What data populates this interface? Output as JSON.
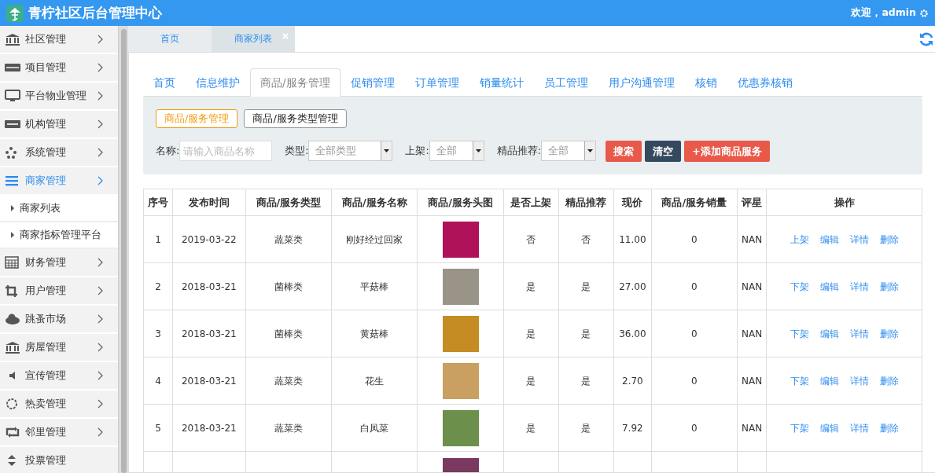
{
  "header": {
    "title": "青柠社区后台管理中心",
    "user": "欢迎，admin"
  },
  "sidebar": {
    "items": [
      {
        "label": "社区管理",
        "selected": false
      },
      {
        "label": "项目管理",
        "selected": false
      },
      {
        "label": "平台物业管理",
        "selected": false
      },
      {
        "label": "机构管理",
        "selected": false
      },
      {
        "label": "系统管理",
        "selected": false
      },
      {
        "label": "商家管理",
        "expanded": true,
        "selected": true,
        "children": [
          {
            "label": "商家列表"
          },
          {
            "label": "商家指标管理平台"
          }
        ]
      },
      {
        "label": "财务管理",
        "selected": false
      },
      {
        "label": "用户管理",
        "selected": false
      },
      {
        "label": "跳蚤市场",
        "selected": false
      },
      {
        "label": "房屋管理",
        "selected": false
      },
      {
        "label": "宣传管理",
        "selected": false
      },
      {
        "label": "热卖管理",
        "selected": false
      },
      {
        "label": "邻里管理",
        "selected": false
      },
      {
        "label": "投票管理",
        "selected": false
      }
    ]
  },
  "page_tabs": [
    {
      "label": "首页",
      "selected": false,
      "closable": false
    },
    {
      "label": "商家列表",
      "selected": true,
      "closable": true
    }
  ],
  "tabs": [
    {
      "label": "首页",
      "selected": false
    },
    {
      "label": "信息维护",
      "selected": false
    },
    {
      "label": "商品/服务管理",
      "selected": true
    },
    {
      "label": "促销管理",
      "selected": false
    },
    {
      "label": "订单管理",
      "selected": false
    },
    {
      "label": "销量统计",
      "selected": false
    },
    {
      "label": "员工管理",
      "selected": false
    },
    {
      "label": "用户沟通管理",
      "selected": false
    },
    {
      "label": "核销",
      "selected": false
    },
    {
      "label": "优惠券核销",
      "selected": false
    }
  ],
  "sub_tabs": [
    {
      "label": "商品/服务管理",
      "selected": true
    },
    {
      "label": "商品/服务类型管理",
      "selected": false
    }
  ],
  "filters": {
    "name": {
      "label": "名称:",
      "placeholder": "请输入商品名称"
    },
    "type": {
      "label": "类型:",
      "value": "全部类型"
    },
    "shelf": {
      "label": "上架:",
      "value": "全部"
    },
    "featured": {
      "label": "精品推荐:",
      "value": "全部"
    }
  },
  "buttons": [
    {
      "label": "搜索",
      "kind": "danger"
    },
    {
      "label": "清空",
      "kind": "dark"
    },
    {
      "label": "+添加商品服务",
      "kind": "danger"
    }
  ],
  "table": {
    "columns": [
      "序号",
      "发布时间",
      "商品/服务类型",
      "商品/服务名称",
      "商品/服务头图",
      "是否上架",
      "精品推荐",
      "现价",
      "商品/服务销量",
      "评星",
      "操作"
    ],
    "rows": [
      {
        "no": "1",
        "date": "2019-03-22",
        "type": "蔬菜类",
        "name": "刚好经过回家",
        "on_shelf": "否",
        "featured": "否",
        "price": "11.00",
        "sales": "0",
        "rating": "NAN",
        "actions": [
          "上架",
          "编辑",
          "详情",
          "删除"
        ]
      },
      {
        "no": "2",
        "date": "2018-03-21",
        "type": "菌棒类",
        "name": "平菇棒",
        "on_shelf": "是",
        "featured": "是",
        "price": "27.00",
        "sales": "0",
        "rating": "NAN",
        "actions": [
          "下架",
          "编辑",
          "详情",
          "删除"
        ]
      },
      {
        "no": "3",
        "date": "2018-03-21",
        "type": "菌棒类",
        "name": "黄菇棒",
        "on_shelf": "是",
        "featured": "是",
        "price": "36.00",
        "sales": "0",
        "rating": "NAN",
        "actions": [
          "下架",
          "编辑",
          "详情",
          "删除"
        ]
      },
      {
        "no": "4",
        "date": "2018-03-21",
        "type": "蔬菜类",
        "name": "花生",
        "on_shelf": "是",
        "featured": "是",
        "price": "2.70",
        "sales": "0",
        "rating": "NAN",
        "actions": [
          "下架",
          "编辑",
          "详情",
          "删除"
        ]
      },
      {
        "no": "5",
        "date": "2018-03-21",
        "type": "蔬菜类",
        "name": "白凤菜",
        "on_shelf": "是",
        "featured": "是",
        "price": "7.92",
        "sales": "0",
        "rating": "NAN",
        "actions": [
          "下架",
          "编辑",
          "详情",
          "删除"
        ]
      }
    ]
  }
}
